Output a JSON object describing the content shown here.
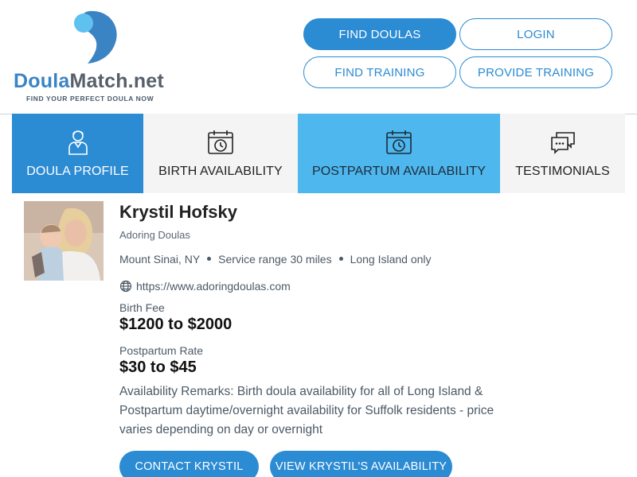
{
  "header": {
    "logo": {
      "name_part1": "Doula",
      "name_part2": "Match.net",
      "tagline": "FIND YOUR PERFECT DOULA NOW"
    },
    "nav": {
      "find_doulas": "FIND DOULAS",
      "login": "LOGIN",
      "find_training": "FIND TRAINING",
      "provide_training": "PROVIDE TRAINING"
    }
  },
  "tabs": [
    {
      "label": "DOULA PROFILE",
      "icon": "doula-person-icon",
      "state": "active"
    },
    {
      "label": "BIRTH AVAILABILITY",
      "icon": "calendar-clock-icon",
      "state": "default"
    },
    {
      "label": "POSTPARTUM AVAILABILITY",
      "icon": "calendar-clock-icon",
      "state": "highlight"
    },
    {
      "label": "TESTIMONIALS",
      "icon": "chat-bubbles-icon",
      "state": "default"
    }
  ],
  "profile": {
    "name": "Krystil Hofsky",
    "agency": "Adoring Doulas",
    "location": "Mount Sinai, NY",
    "service_range": "Service range 30 miles",
    "area": "Long Island only",
    "website": "https://www.adoringdoulas.com",
    "birth_fee_label": "Birth Fee",
    "birth_fee": "$1200 to $2000",
    "postpartum_label": "Postpartum Rate",
    "postpartum_rate": "$30 to $45",
    "remarks": "Availability Remarks: Birth doula availability for all of Long Island & Postpartum daytime/overnight availability for Suffolk residents - price varies depending on day or overnight"
  },
  "actions": {
    "contact": "CONTACT KRYSTIL",
    "view_availability": "VIEW KRYSTIL'S AVAILABILITY"
  },
  "colors": {
    "primary": "#2b8bd3",
    "highlight_tab": "#4db7ee",
    "tab_bg": "#f4f4f4"
  }
}
